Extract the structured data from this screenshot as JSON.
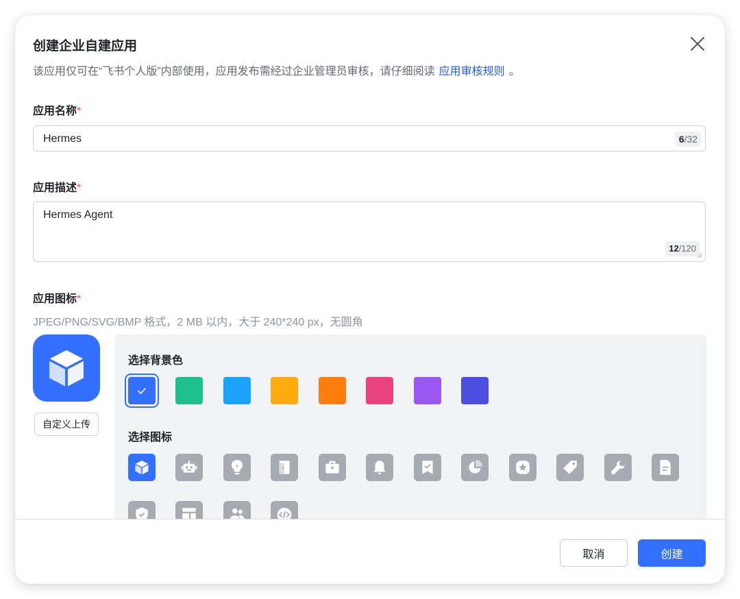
{
  "dialog": {
    "title": "创建企业自建应用",
    "notice": "该应用仅可在“飞书个人版”内部使用，应用发布需经过企业管理员审核，请仔细阅读",
    "notice_link": "应用审核规则",
    "notice_end": "。"
  },
  "app_name": {
    "label": "应用名称",
    "required_mark": "*",
    "value": "Hermes",
    "count": "6",
    "max": "/32"
  },
  "app_desc": {
    "label": "应用描述",
    "required_mark": "*",
    "value": "Hermes Agent",
    "count": "12",
    "max": "/120"
  },
  "app_icon": {
    "label": "应用图标",
    "required_mark": "*",
    "hint": "JPEG/PNG/SVG/BMP 格式，2 MB 以内，大于 240*240 px，无圆角",
    "custom_upload": "自定义上传",
    "bg_title": "选择背景色",
    "icon_title": "选择图标",
    "colors": [
      "#3370ff",
      "#1fbf8c",
      "#1aa3ff",
      "#ffab0f",
      "#ff7d0f",
      "#e8437d",
      "#9a57f2",
      "#4b4fe0"
    ],
    "selected_color": "#3370ff",
    "icons": [
      "cube-icon",
      "robot-icon",
      "lightbulb-icon",
      "door-icon",
      "briefcase-icon",
      "bell-icon",
      "bookmark-check-icon",
      "pie-chart-icon",
      "star-badge-icon",
      "tag-icon",
      "wrench-icon",
      "document-icon",
      "shield-check-icon",
      "layout-icon",
      "people-icon",
      "code-icon"
    ],
    "selected_icon": "cube-icon"
  },
  "footer": {
    "cancel": "取消",
    "create": "创建"
  }
}
